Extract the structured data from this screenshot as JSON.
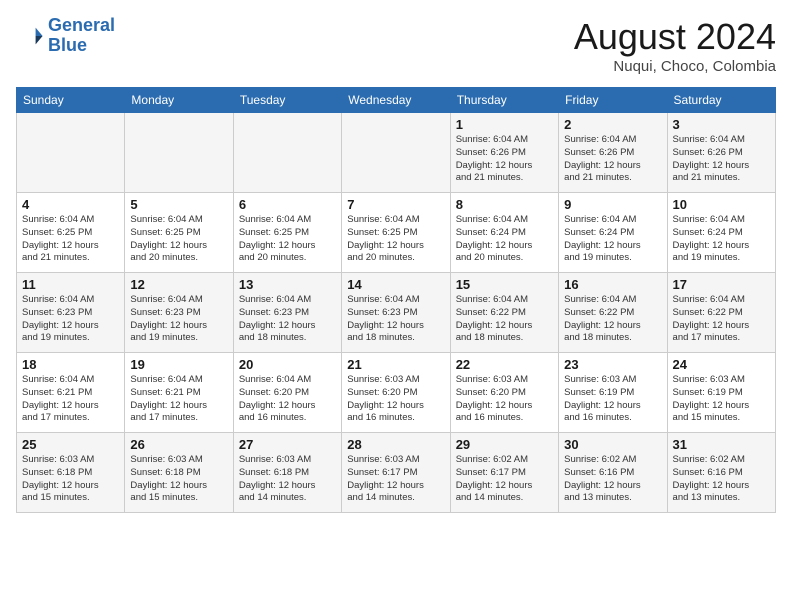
{
  "header": {
    "logo_line1": "General",
    "logo_line2": "Blue",
    "month": "August 2024",
    "location": "Nuqui, Choco, Colombia"
  },
  "weekdays": [
    "Sunday",
    "Monday",
    "Tuesday",
    "Wednesday",
    "Thursday",
    "Friday",
    "Saturday"
  ],
  "weeks": [
    [
      {
        "day": "",
        "info": ""
      },
      {
        "day": "",
        "info": ""
      },
      {
        "day": "",
        "info": ""
      },
      {
        "day": "",
        "info": ""
      },
      {
        "day": "1",
        "info": "Sunrise: 6:04 AM\nSunset: 6:26 PM\nDaylight: 12 hours\nand 21 minutes."
      },
      {
        "day": "2",
        "info": "Sunrise: 6:04 AM\nSunset: 6:26 PM\nDaylight: 12 hours\nand 21 minutes."
      },
      {
        "day": "3",
        "info": "Sunrise: 6:04 AM\nSunset: 6:26 PM\nDaylight: 12 hours\nand 21 minutes."
      }
    ],
    [
      {
        "day": "4",
        "info": "Sunrise: 6:04 AM\nSunset: 6:25 PM\nDaylight: 12 hours\nand 21 minutes."
      },
      {
        "day": "5",
        "info": "Sunrise: 6:04 AM\nSunset: 6:25 PM\nDaylight: 12 hours\nand 20 minutes."
      },
      {
        "day": "6",
        "info": "Sunrise: 6:04 AM\nSunset: 6:25 PM\nDaylight: 12 hours\nand 20 minutes."
      },
      {
        "day": "7",
        "info": "Sunrise: 6:04 AM\nSunset: 6:25 PM\nDaylight: 12 hours\nand 20 minutes."
      },
      {
        "day": "8",
        "info": "Sunrise: 6:04 AM\nSunset: 6:24 PM\nDaylight: 12 hours\nand 20 minutes."
      },
      {
        "day": "9",
        "info": "Sunrise: 6:04 AM\nSunset: 6:24 PM\nDaylight: 12 hours\nand 19 minutes."
      },
      {
        "day": "10",
        "info": "Sunrise: 6:04 AM\nSunset: 6:24 PM\nDaylight: 12 hours\nand 19 minutes."
      }
    ],
    [
      {
        "day": "11",
        "info": "Sunrise: 6:04 AM\nSunset: 6:23 PM\nDaylight: 12 hours\nand 19 minutes."
      },
      {
        "day": "12",
        "info": "Sunrise: 6:04 AM\nSunset: 6:23 PM\nDaylight: 12 hours\nand 19 minutes."
      },
      {
        "day": "13",
        "info": "Sunrise: 6:04 AM\nSunset: 6:23 PM\nDaylight: 12 hours\nand 18 minutes."
      },
      {
        "day": "14",
        "info": "Sunrise: 6:04 AM\nSunset: 6:23 PM\nDaylight: 12 hours\nand 18 minutes."
      },
      {
        "day": "15",
        "info": "Sunrise: 6:04 AM\nSunset: 6:22 PM\nDaylight: 12 hours\nand 18 minutes."
      },
      {
        "day": "16",
        "info": "Sunrise: 6:04 AM\nSunset: 6:22 PM\nDaylight: 12 hours\nand 18 minutes."
      },
      {
        "day": "17",
        "info": "Sunrise: 6:04 AM\nSunset: 6:22 PM\nDaylight: 12 hours\nand 17 minutes."
      }
    ],
    [
      {
        "day": "18",
        "info": "Sunrise: 6:04 AM\nSunset: 6:21 PM\nDaylight: 12 hours\nand 17 minutes."
      },
      {
        "day": "19",
        "info": "Sunrise: 6:04 AM\nSunset: 6:21 PM\nDaylight: 12 hours\nand 17 minutes."
      },
      {
        "day": "20",
        "info": "Sunrise: 6:04 AM\nSunset: 6:20 PM\nDaylight: 12 hours\nand 16 minutes."
      },
      {
        "day": "21",
        "info": "Sunrise: 6:03 AM\nSunset: 6:20 PM\nDaylight: 12 hours\nand 16 minutes."
      },
      {
        "day": "22",
        "info": "Sunrise: 6:03 AM\nSunset: 6:20 PM\nDaylight: 12 hours\nand 16 minutes."
      },
      {
        "day": "23",
        "info": "Sunrise: 6:03 AM\nSunset: 6:19 PM\nDaylight: 12 hours\nand 16 minutes."
      },
      {
        "day": "24",
        "info": "Sunrise: 6:03 AM\nSunset: 6:19 PM\nDaylight: 12 hours\nand 15 minutes."
      }
    ],
    [
      {
        "day": "25",
        "info": "Sunrise: 6:03 AM\nSunset: 6:18 PM\nDaylight: 12 hours\nand 15 minutes."
      },
      {
        "day": "26",
        "info": "Sunrise: 6:03 AM\nSunset: 6:18 PM\nDaylight: 12 hours\nand 15 minutes."
      },
      {
        "day": "27",
        "info": "Sunrise: 6:03 AM\nSunset: 6:18 PM\nDaylight: 12 hours\nand 14 minutes."
      },
      {
        "day": "28",
        "info": "Sunrise: 6:03 AM\nSunset: 6:17 PM\nDaylight: 12 hours\nand 14 minutes."
      },
      {
        "day": "29",
        "info": "Sunrise: 6:02 AM\nSunset: 6:17 PM\nDaylight: 12 hours\nand 14 minutes."
      },
      {
        "day": "30",
        "info": "Sunrise: 6:02 AM\nSunset: 6:16 PM\nDaylight: 12 hours\nand 13 minutes."
      },
      {
        "day": "31",
        "info": "Sunrise: 6:02 AM\nSunset: 6:16 PM\nDaylight: 12 hours\nand 13 minutes."
      }
    ]
  ]
}
